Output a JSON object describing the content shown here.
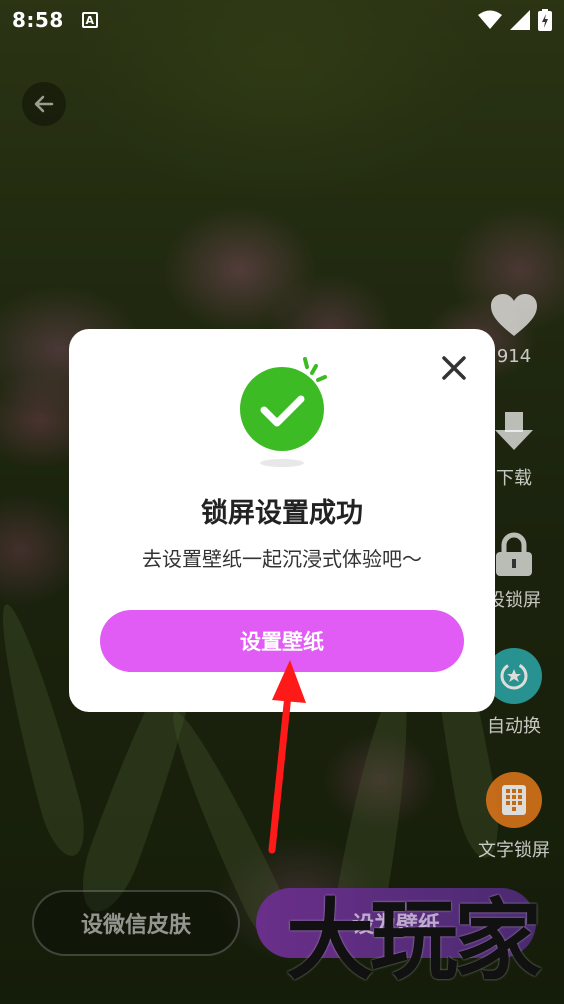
{
  "status_bar": {
    "time": "8:58",
    "notification_icon": "A"
  },
  "side_actions": {
    "like_count": "914",
    "download_label": "下载",
    "lock_label": "设锁屏",
    "auto_label": "自动换",
    "text_lock_label": "文字锁屏"
  },
  "bottom": {
    "wechat_skin_label": "设微信皮肤",
    "set_wallpaper_label": "设为壁纸"
  },
  "dialog": {
    "title": "锁屏设置成功",
    "subtitle": "去设置壁纸一起沉浸式体验吧～",
    "primary_button": "设置壁纸"
  },
  "watermark": "大玩家",
  "colors": {
    "accent": "#e05cf4",
    "success": "#3dbb24",
    "annotation_arrow": "#ff1a1a",
    "auto_icon": "#2aa6a8",
    "text_lock_icon": "#e0771a"
  }
}
